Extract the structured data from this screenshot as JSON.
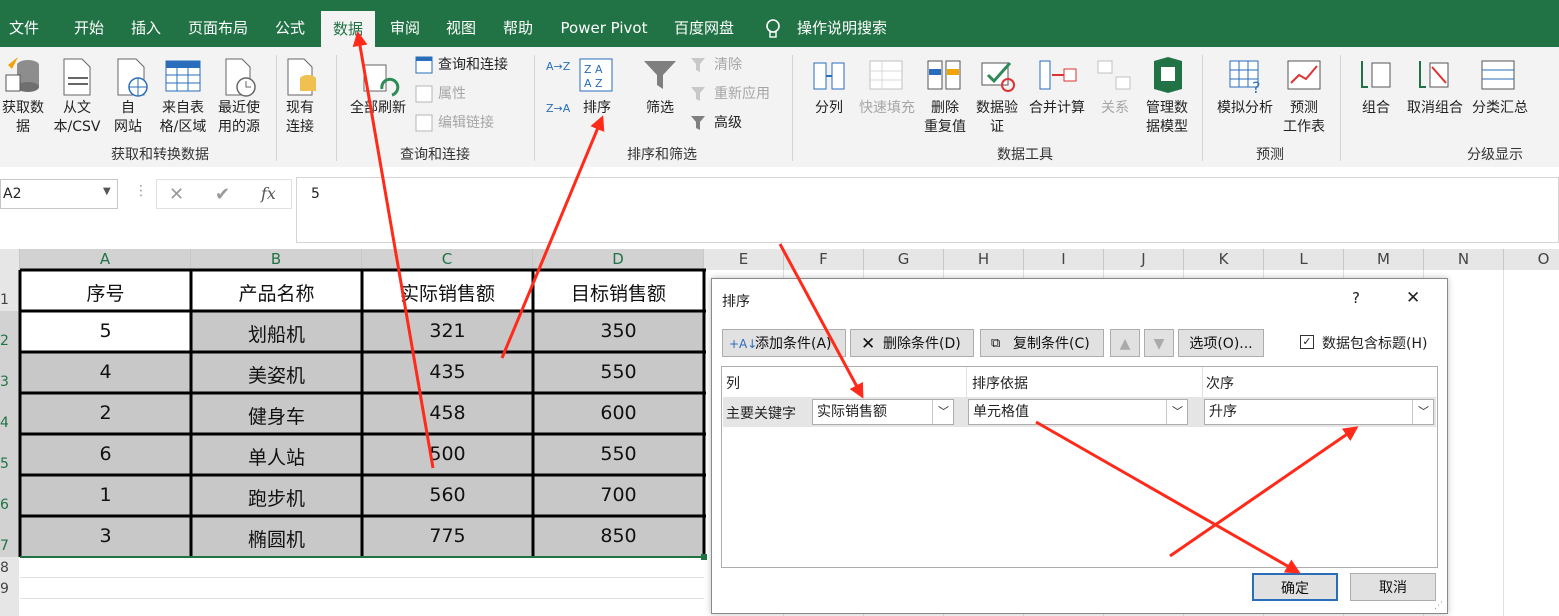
{
  "tabs": [
    "文件",
    "开始",
    "插入",
    "页面布局",
    "公式",
    "数据",
    "审阅",
    "视图",
    "帮助",
    "Power Pivot",
    "百度网盘",
    "操作说明搜索"
  ],
  "ribbon": {
    "get_data": "获取数\n据",
    "from_text": "从文\n本/CSV",
    "from_web": "自\n网站",
    "from_table": "来自表\n格/区域",
    "recent_sources": "最近使\n用的源",
    "existing_conn": "现有\n连接",
    "group_get_transform": "获取和转换数据",
    "refresh_all": "全部刷新",
    "queries_conn": "查询和连接",
    "properties": "属性",
    "edit_links": "编辑链接",
    "group_queries": "查询和连接",
    "sort_az": "A→Z",
    "sort_za": "Z→A",
    "sort": "排序",
    "filter": "筛选",
    "clear": "清除",
    "reapply": "重新应用",
    "advanced": "高级",
    "group_sort_filter": "排序和筛选",
    "text_to_cols": "分列",
    "flash_fill": "快速填充",
    "remove_dup": "删除\n重复值",
    "data_valid": "数据验\n证",
    "consolidate": "合并计算",
    "relations": "关系",
    "data_model": "管理数\n据模型",
    "group_data_tools": "数据工具",
    "whatif": "模拟分析",
    "forecast": "预测\n工作表",
    "group_forecast": "预测",
    "group": "组合",
    "ungroup": "取消组合",
    "subtotal": "分类汇总",
    "group_outline": "分级显示"
  },
  "formula_bar": {
    "name_box": "A2",
    "value": "5",
    "fx": "fx"
  },
  "columns": [
    "A",
    "B",
    "C",
    "D",
    "E",
    "F",
    "G",
    "H",
    "I",
    "J",
    "K",
    "L",
    "M",
    "N",
    "O"
  ],
  "rows": [
    "1",
    "2",
    "3",
    "4",
    "5",
    "6",
    "7",
    "8",
    "9"
  ],
  "table": {
    "headers": [
      "序号",
      "产品名称",
      "实际销售额",
      "目标销售额"
    ],
    "rows": [
      [
        "5",
        "划船机",
        "321",
        "350"
      ],
      [
        "4",
        "美姿机",
        "435",
        "550"
      ],
      [
        "2",
        "健身车",
        "458",
        "600"
      ],
      [
        "6",
        "单人站",
        "500",
        "550"
      ],
      [
        "1",
        "跑步机",
        "560",
        "700"
      ],
      [
        "3",
        "椭圆机",
        "775",
        "850"
      ]
    ]
  },
  "dialog": {
    "title": "排序",
    "help": "?",
    "close": "✕",
    "add_level": "添加条件(A)",
    "delete_level": "删除条件(D)",
    "copy_level": "复制条件(C)",
    "options": "选项(O)...",
    "has_headers": "数据包含标题(H)",
    "col_header": "列",
    "sorton_header": "排序依据",
    "order_header": "次序",
    "primary_key": "主要关键字",
    "sort_by": "实际销售额",
    "sort_on": "单元格值",
    "order": "升序",
    "ok": "确定",
    "cancel": "取消"
  },
  "colors": {
    "excel_green": "#217346",
    "arrow_red": "#ff2a1a",
    "selection_gray": "#c8c8c8"
  }
}
